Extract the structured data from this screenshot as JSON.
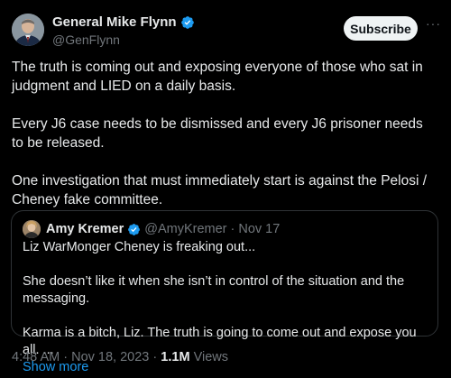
{
  "author": {
    "display_name": "General Mike Flynn",
    "handle": "@GenFlynn"
  },
  "subscribe_label": "Subscribe",
  "more_label": "···",
  "tweet": {
    "paragraphs": [
      "The truth is coming out and exposing everyone of those who sat in judgment and LIED on a daily basis.",
      "Every J6 case needs to be dismissed and every J6 prisoner needs to be released.",
      "One investigation that must immediately start is against the Pelosi / Cheney fake committee."
    ]
  },
  "quote": {
    "display_name": "Amy Kremer",
    "handle": "@AmyKremer",
    "separator": "·",
    "date": "Nov 17",
    "paragraphs": [
      "Liz WarMonger Cheney  is freaking out...",
      "She doesn’t like it when she isn’t in control of the situation and the messaging.",
      "Karma is a bitch, Liz.  The truth is going to come out and expose you all. ..."
    ],
    "show_more": "Show more"
  },
  "meta": {
    "time": "4:48 AM",
    "separator": "·",
    "date": "Nov 18, 2023",
    "views_count": "1.1M",
    "views_label": "Views"
  },
  "colors": {
    "background": "#000000",
    "text": "#e7e9ea",
    "muted": "#71767b",
    "accent": "#1d9bf0",
    "border": "#2f3336"
  },
  "icons": {
    "verified": "verified-badge-icon",
    "more": "more-horizontal-icon"
  }
}
